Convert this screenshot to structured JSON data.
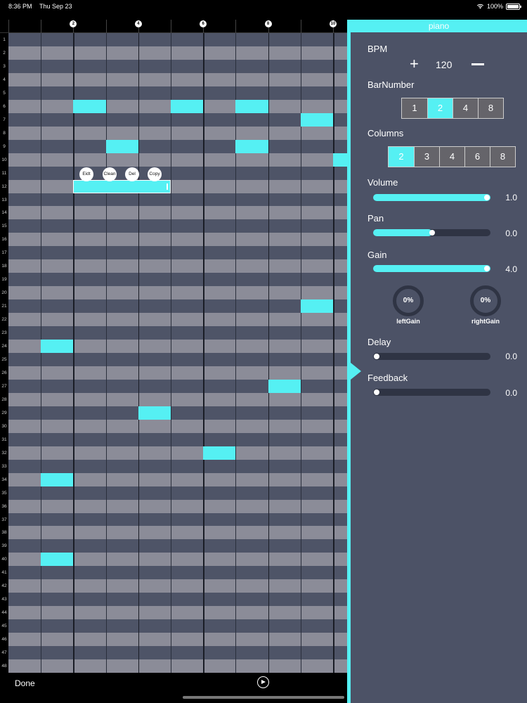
{
  "status": {
    "time": "8:36 PM",
    "date": "Thu Sep 23",
    "battery": "100%"
  },
  "ruler": {
    "markers": [
      "2",
      "4",
      "6",
      "8",
      "10"
    ]
  },
  "rows": [
    "1",
    "2",
    "3",
    "4",
    "5",
    "6",
    "7",
    "8",
    "9",
    "10",
    "11",
    "12",
    "13",
    "14",
    "15",
    "16",
    "17",
    "18",
    "19",
    "20",
    "21",
    "22",
    "23",
    "24",
    "25",
    "26",
    "27",
    "28",
    "29",
    "30",
    "31",
    "32",
    "33",
    "34",
    "35",
    "36",
    "37",
    "38",
    "39",
    "40",
    "41",
    "42",
    "43",
    "44",
    "45",
    "46",
    "47",
    "48"
  ],
  "note_actions": {
    "edit": "Eidt",
    "clean": "Clean",
    "del": "Del",
    "copy": "Copy"
  },
  "toolbar": {
    "done": "Done"
  },
  "panel": {
    "title": "piano",
    "bpm": {
      "label": "BPM",
      "value": "120",
      "plus": "+"
    },
    "bar_number": {
      "label": "BarNumber",
      "options": [
        "1",
        "2",
        "4",
        "8"
      ],
      "selected": "2"
    },
    "columns": {
      "label": "Columns",
      "options": [
        "2",
        "3",
        "4",
        "6",
        "8"
      ],
      "selected": "2"
    },
    "volume": {
      "label": "Volume",
      "value": "1.0",
      "level": 1.0
    },
    "pan": {
      "label": "Pan",
      "value": "0.0",
      "level": 0.5
    },
    "gain": {
      "label": "Gain",
      "value": "4.0",
      "level": 1.0
    },
    "left_gain": {
      "label": "leftGain",
      "value": "0%"
    },
    "right_gain": {
      "label": "rightGain",
      "value": "0%"
    },
    "delay": {
      "label": "Delay",
      "value": "0.0",
      "level": 0.0
    },
    "feedback": {
      "label": "Feedback",
      "value": "0.0",
      "level": 0.0
    }
  },
  "colors": {
    "accent": "#55f0f3",
    "panel_bg": "#4c5266",
    "row_light": "#8b8c98",
    "row_dark": "#4e5467"
  }
}
